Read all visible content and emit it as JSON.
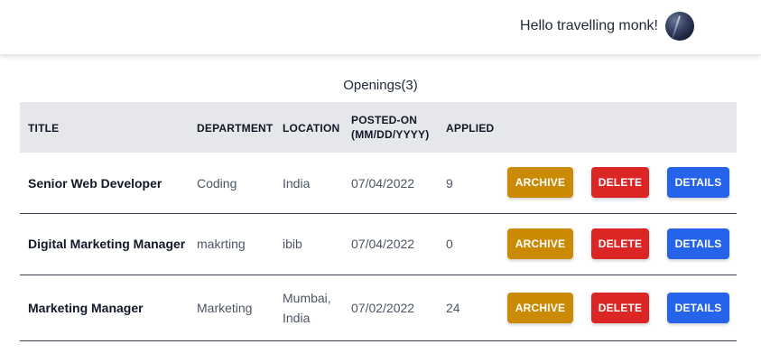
{
  "header": {
    "greeting": "Hello travelling monk!"
  },
  "openings": {
    "title": "Openings(3)"
  },
  "table": {
    "columns": {
      "title": "TITLE",
      "department": "DEPARTMENT",
      "location": "LOCATION",
      "posted_on_line1": "POSTED-ON",
      "posted_on_line2": "(MM/DD/YYYY)",
      "applied": "APPLIED"
    },
    "actions": {
      "archive": "ARCHIVE",
      "delete": "DELETE",
      "details": "DETAILS"
    },
    "rows": [
      {
        "title": "Senior Web Developer",
        "department": "Coding",
        "location_line1": "India",
        "location_line2": "",
        "posted_on": "07/04/2022",
        "applied": "9"
      },
      {
        "title": "Digital Marketing Manager",
        "department": "makrting",
        "location_line1": "ibib",
        "location_line2": "",
        "posted_on": "07/04/2022",
        "applied": "0"
      },
      {
        "title": "Marketing Manager",
        "department": "Marketing",
        "location_line1": "Mumbai,",
        "location_line2": "India",
        "posted_on": "07/02/2022",
        "applied": "24"
      }
    ]
  },
  "colors": {
    "archive": "#ca8a04",
    "delete": "#dc2626",
    "details": "#2563eb",
    "header_bg": "#e5e7eb"
  }
}
